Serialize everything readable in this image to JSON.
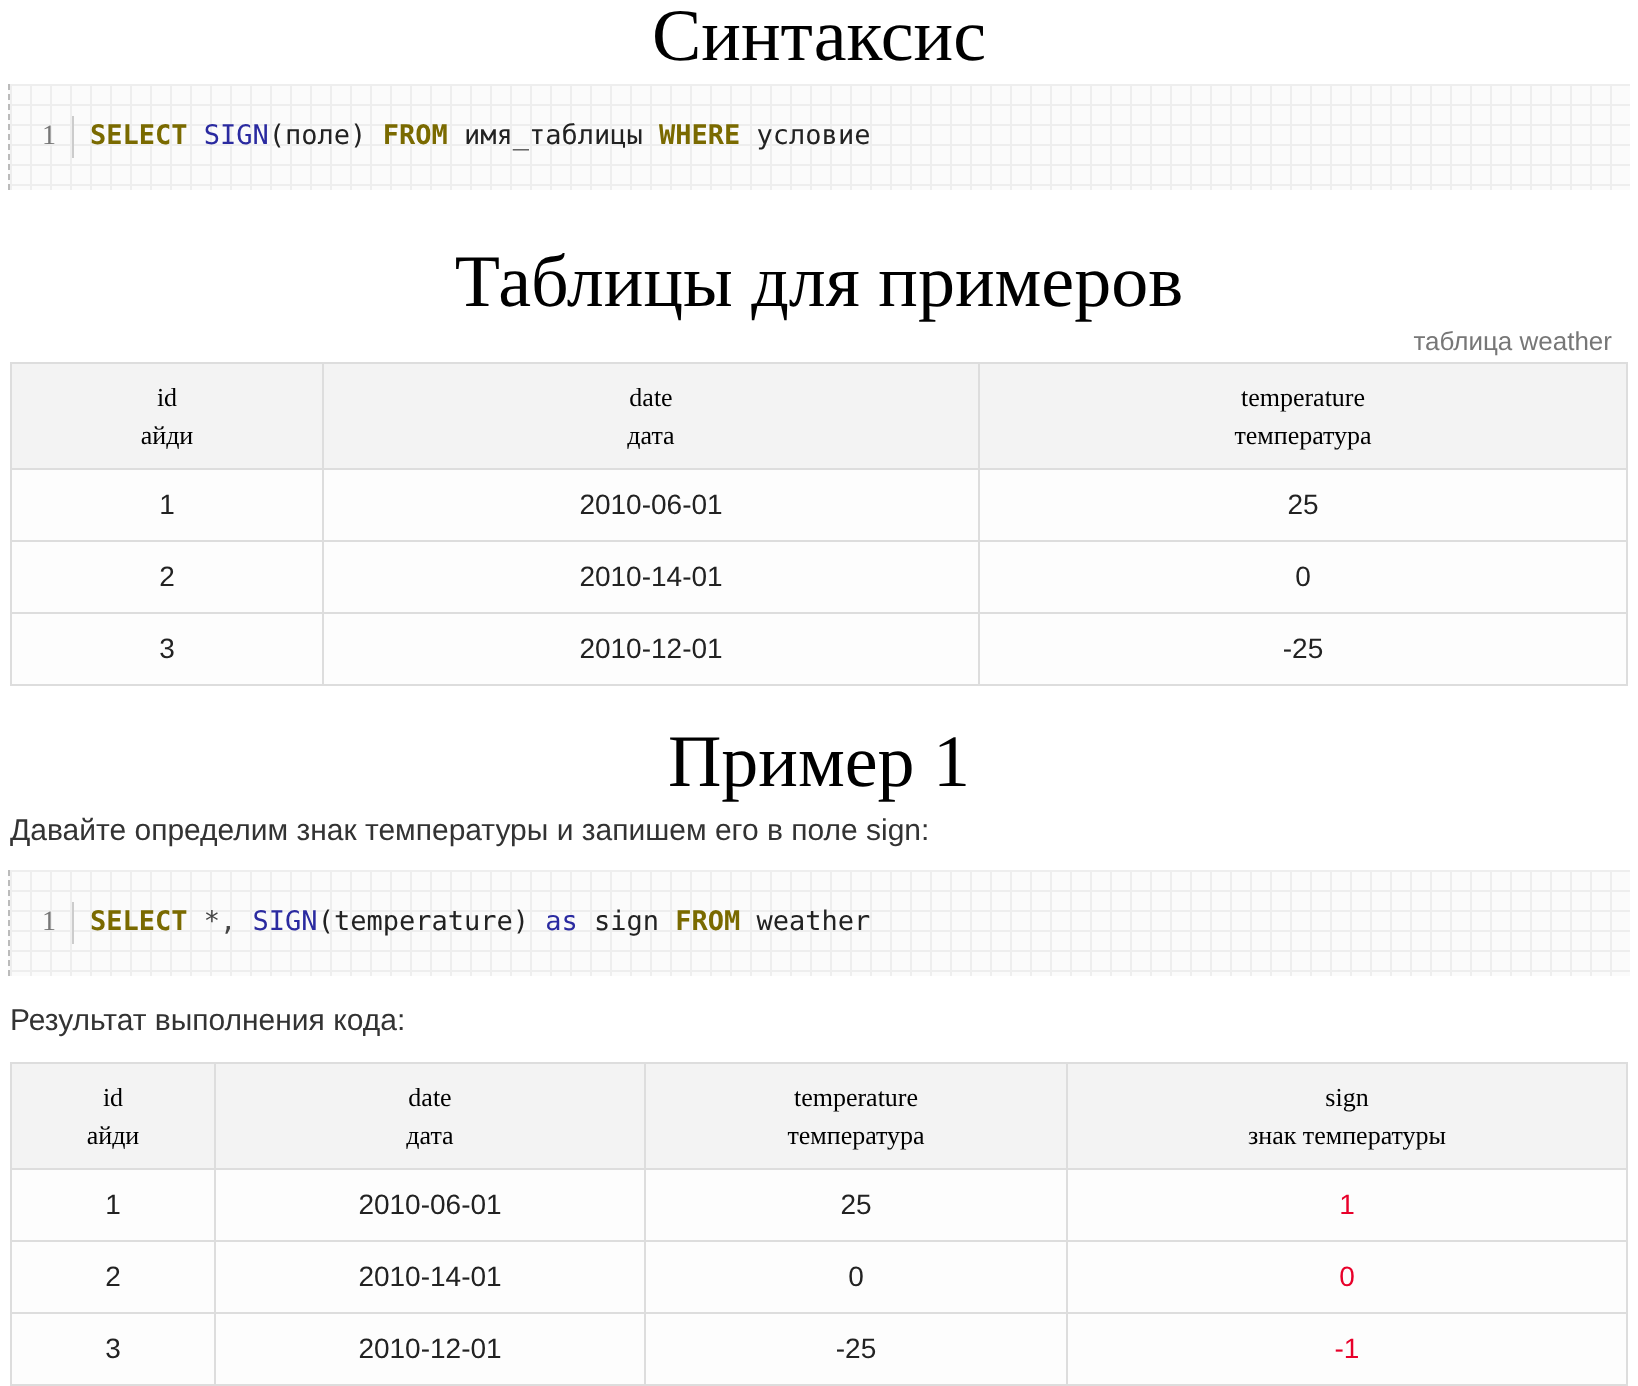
{
  "sections": [
    {
      "heading": "Синтаксис",
      "blocks": [
        {
          "kind": "code",
          "line_number": "1",
          "tokens": [
            {
              "kind": "keyword",
              "text": "SELECT"
            },
            {
              "kind": "function",
              "text": " SIGN"
            },
            {
              "kind": "plain",
              "text": "(поле)"
            },
            {
              "kind": "keyword",
              "text": " FROM"
            },
            {
              "kind": "plain",
              "text": " имя_таблицы"
            },
            {
              "kind": "keyword",
              "text": " WHERE"
            },
            {
              "kind": "plain",
              "text": " условие"
            }
          ]
        }
      ]
    },
    {
      "heading": "Таблицы для примеров",
      "blocks": [
        {
          "kind": "table",
          "caption": "таблица weather",
          "columns": [
            {
              "name": "id",
              "subtitle": "айди",
              "highlight": false
            },
            {
              "name": "date",
              "subtitle": "дата",
              "highlight": false
            },
            {
              "name": "temperature",
              "subtitle": "температура",
              "highlight": false
            }
          ],
          "rows": [
            [
              "1",
              "2010-06-01",
              "25"
            ],
            [
              "2",
              "2010-14-01",
              "0"
            ],
            [
              "3",
              "2010-12-01",
              "-25"
            ]
          ]
        }
      ]
    },
    {
      "heading": "Пример 1",
      "blocks": [
        {
          "kind": "paragraph",
          "text": "Давайте определим знак температуры и запишем его в поле sign:"
        },
        {
          "kind": "code",
          "line_number": "1",
          "tokens": [
            {
              "kind": "keyword",
              "text": "SELECT"
            },
            {
              "kind": "operator",
              "text": " *,"
            },
            {
              "kind": "function",
              "text": " SIGN"
            },
            {
              "kind": "plain",
              "text": "(temperature)"
            },
            {
              "kind": "function",
              "text": " as"
            },
            {
              "kind": "plain",
              "text": " sign"
            },
            {
              "kind": "keyword",
              "text": " FROM"
            },
            {
              "kind": "plain",
              "text": " weather"
            }
          ]
        },
        {
          "kind": "paragraph",
          "text": "Результат выполнения кода:"
        },
        {
          "kind": "table",
          "columns": [
            {
              "name": "id",
              "subtitle": "айди",
              "highlight": false
            },
            {
              "name": "date",
              "subtitle": "дата",
              "highlight": false
            },
            {
              "name": "temperature",
              "subtitle": "температура",
              "highlight": false
            },
            {
              "name": "sign",
              "subtitle": "знак температуры",
              "highlight": true
            }
          ],
          "rows": [
            [
              "1",
              "2010-06-01",
              "25",
              "1"
            ],
            [
              "2",
              "2010-14-01",
              "0",
              "0"
            ],
            [
              "3",
              "2010-12-01",
              "-25",
              "-1"
            ]
          ]
        }
      ]
    }
  ]
}
